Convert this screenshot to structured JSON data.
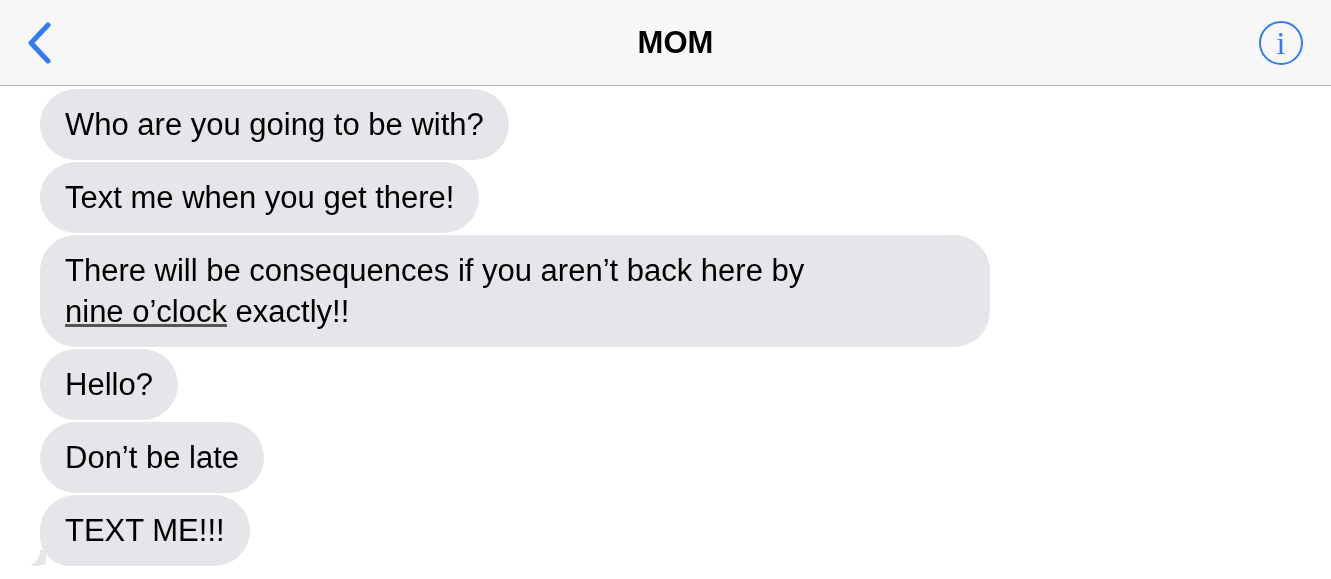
{
  "header": {
    "title": "MOM",
    "info": "i"
  },
  "messages": [
    {
      "parts": [
        {
          "text": "Who are you going to be with?",
          "link": false
        }
      ],
      "tail": false
    },
    {
      "parts": [
        {
          "text": "Text me when you get there!",
          "link": false
        }
      ],
      "tail": false
    },
    {
      "parts": [
        {
          "text": "There will be consequences if you aren’t back here by ",
          "link": false
        },
        {
          "text": "nine o’clock",
          "link": true
        },
        {
          "text": " exactly!!",
          "link": false
        }
      ],
      "tail": false
    },
    {
      "parts": [
        {
          "text": "Hello?",
          "link": false
        }
      ],
      "tail": false
    },
    {
      "parts": [
        {
          "text": "Don’t be late",
          "link": false
        }
      ],
      "tail": false
    },
    {
      "parts": [
        {
          "text": "TEXT ME!!!",
          "link": false
        }
      ],
      "tail": true
    }
  ]
}
